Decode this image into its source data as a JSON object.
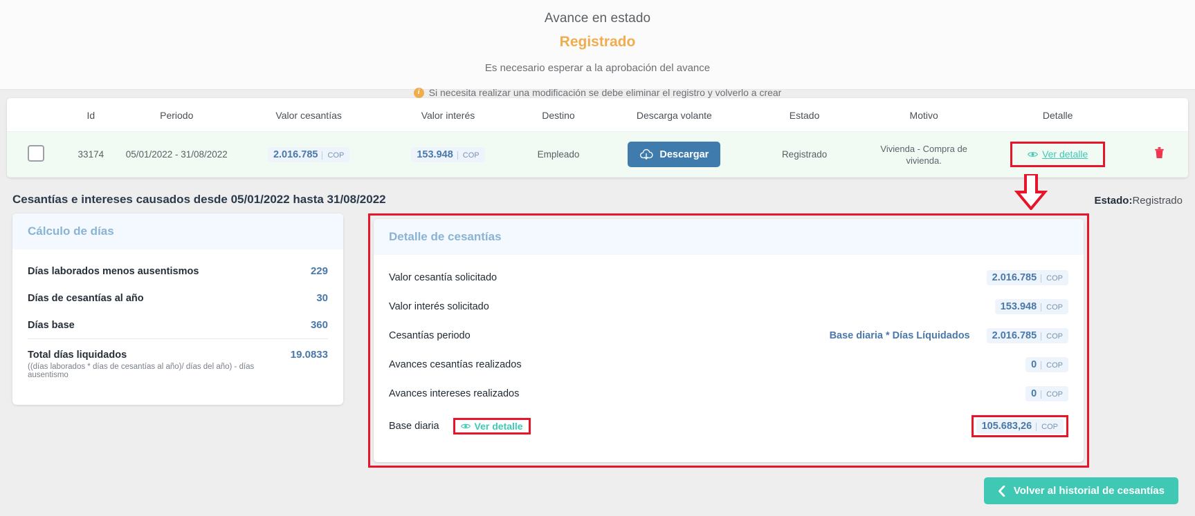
{
  "status_banner": {
    "title": "Avance en estado",
    "state": "Registrado",
    "subtitle": "Es necesario esperar a la aprobación del avance",
    "note": "Si necesita realizar una modificación se debe eliminar el registro y volverlo a crear",
    "info_icon": "info-circle-icon",
    "state_color": "#f0ad4e"
  },
  "table": {
    "headers": {
      "checkbox": "",
      "id": "Id",
      "periodo": "Periodo",
      "valor_cesantias": "Valor cesantías",
      "valor_interes": "Valor interés",
      "destino": "Destino",
      "descarga_volante": "Descarga volante",
      "estado": "Estado",
      "motivo": "Motivo",
      "detalle": "Detalle",
      "acciones": ""
    },
    "row": {
      "id": "33174",
      "periodo": "05/01/2022 - 31/08/2022",
      "valor_cesantias": "2.016.785",
      "valor_cesantias_currency": "COP",
      "valor_interes": "153.948",
      "valor_interes_currency": "COP",
      "destino": "Empleado",
      "descargar_label": "Descargar",
      "descargar_icon": "cloud-download-icon",
      "estado": "Registrado",
      "motivo": "Vivienda - Compra de vivienda.",
      "ver_detalle": "Ver detalle",
      "eye_icon": "eye-icon",
      "trash_icon": "trash-icon"
    }
  },
  "detail": {
    "title": "Cesantías e intereses causados desde 05/01/2022 hasta 31/08/2022",
    "estado_label": "Estado:",
    "estado_value": "Registrado",
    "calculo_dias": {
      "header": "Cálculo de días",
      "rows": [
        {
          "label": "Días laborados menos ausentismos",
          "value": "229"
        },
        {
          "label": "Días de cesantías al año",
          "value": "30"
        },
        {
          "label": "Días base",
          "value": "360"
        }
      ],
      "total": {
        "label": "Total días liquidados",
        "formula": "((días laborados * días de cesantías al año)/ días del año) - días ausentismo",
        "value": "19.0833"
      }
    },
    "detalle_cesantias": {
      "header": "Detalle de cesantías",
      "rows": [
        {
          "label": "Valor cesantía solicitado",
          "formula": "",
          "value": "2.016.785",
          "currency": "COP"
        },
        {
          "label": "Valor interés solicitado",
          "formula": "",
          "value": "153.948",
          "currency": "COP"
        },
        {
          "label": "Cesantías periodo",
          "formula": "Base diaria * Días Líquidados",
          "value": "2.016.785",
          "currency": "COP"
        },
        {
          "label": "Avances cesantías realizados",
          "formula": "",
          "value": "0",
          "currency": "COP"
        },
        {
          "label": "Avances intereses realizados",
          "formula": "",
          "value": "0",
          "currency": "COP"
        }
      ],
      "base_diaria": {
        "label": "Base diaria",
        "link": "Ver detalle",
        "eye_icon": "eye-icon",
        "value": "105.683,26",
        "currency": "COP"
      }
    }
  },
  "footer": {
    "back_button": "Volver al historial de cesantías",
    "back_icon": "chevron-left-icon"
  },
  "annotations": {
    "arrow_icon": "red-down-arrow-icon",
    "highlight_color": "#e8142a"
  },
  "colors": {
    "accent_teal": "#3fc8b4",
    "accent_blue": "#3f7cad",
    "value_blue": "#4a78a8",
    "warning": "#f0ad4e",
    "row_green": "#f1fbf4"
  }
}
